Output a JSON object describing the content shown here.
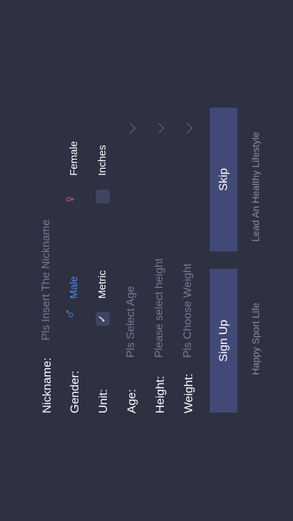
{
  "form": {
    "nickname": {
      "label": "Nickname:",
      "placeholder": "Pls Insert The Nickname"
    },
    "gender": {
      "label": "Gender:",
      "options": [
        {
          "label": "Male",
          "icon": "male-symbol-icon",
          "color": "#4a8ef0",
          "selected": true
        },
        {
          "label": "Female",
          "icon": "female-symbol-icon",
          "color": "#f0607a",
          "selected": false
        }
      ]
    },
    "unit": {
      "label": "Unit:",
      "options": [
        {
          "label": "Metric",
          "selected": true
        },
        {
          "label": "Inches",
          "selected": false
        }
      ]
    },
    "age": {
      "label": "Age:",
      "placeholder": "Pls Select Age"
    },
    "height": {
      "label": "Height:",
      "placeholder": "Please select height"
    },
    "weight": {
      "label": "Weight:",
      "placeholder": "Pls Choose Weight"
    }
  },
  "buttons": {
    "signup": "Sign Up",
    "skip": "Skip"
  },
  "taglines": {
    "left": "Happy Sport Life",
    "right": "Lead An Healthy Lifestyle"
  },
  "colors": {
    "background": "#2e3142",
    "button": "#414977",
    "male": "#4a8ef0",
    "female": "#f0607a"
  }
}
